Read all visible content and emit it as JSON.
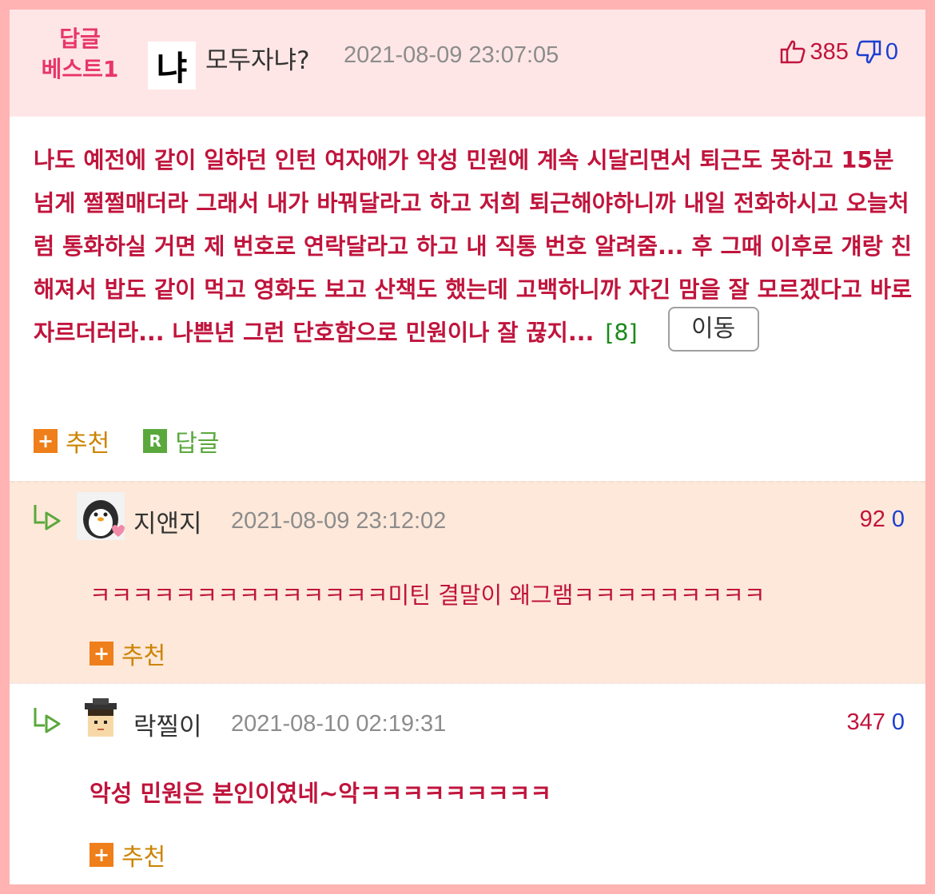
{
  "best": {
    "badge_line1": "답글",
    "badge_line2": "베스트1",
    "avatar_text": "냐",
    "nickname": "모두자냐?",
    "datetime": "2021-08-09 23:07:05",
    "upvotes": "385",
    "downvotes": "0",
    "text": "나도 예전에 같이 일하던 인턴 여자애가 악성 민원에 계속 시달리면서 퇴근도 못하고 15분 넘게 쩔쩔매더라 그래서 내가 바꿔달라고 하고 저희 퇴근해야하니까 내일 전화하시고 오늘처럼 통화하실 거면 제 번호로 연락달라고 하고 내 직통 번호 알려줌... 후 그때 이후로 걔랑 친해져서 밥도 같이 먹고 영화도 보고 산책도 했는데 고백하니까 자긴 맘을 잘 모르겠다고 바로 자르더러라... 나쁜년 그런 단호함으로 민원이나 잘 끊지...",
    "reply_count": "[8]",
    "move_button": "이동",
    "recommend_label": "추천",
    "reply_label": "답글"
  },
  "comments": [
    {
      "nickname": "지앤지",
      "datetime": "2021-08-09 23:12:02",
      "upvotes": "92",
      "downvotes": "0",
      "text": "ㅋㅋㅋㅋㅋㅋㅋㅋㅋㅋㅋㅋㅋㅋ미틴 결말이 왜그램ㅋㅋㅋㅋㅋㅋㅋㅋㅋ",
      "recommend_label": "추천",
      "avatar": "penguin-avatar"
    },
    {
      "nickname": "락찔이",
      "datetime": "2021-08-10 02:19:31",
      "upvotes": "347",
      "downvotes": "0",
      "text": "악성 민원은 본인이였네~악ㅋㅋㅋㅋㅋㅋㅋㅋㅋ",
      "recommend_label": "추천",
      "avatar": "graduate-avatar"
    }
  ],
  "colors": {
    "frame": "#ffb3b3",
    "header_bg": "#ffe6e6",
    "comment1_bg": "#fde8d9",
    "text_red": "#c0143c",
    "badge_pink": "#e8356a",
    "down_blue": "#1a3fd0",
    "recommend_orange": "#ef7f1a",
    "reply_green": "#5aa83c"
  }
}
